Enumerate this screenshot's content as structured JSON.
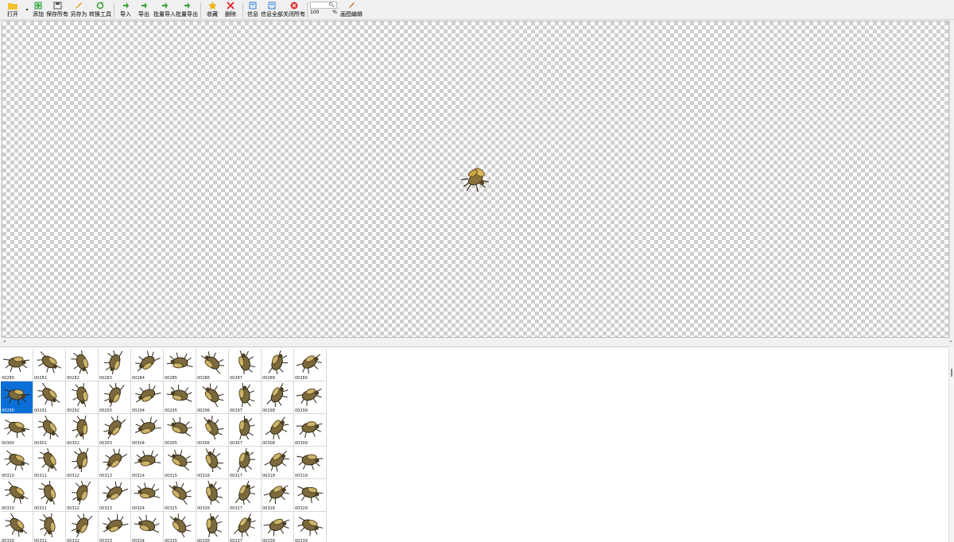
{
  "toolbar": {
    "items": [
      {
        "id": "open",
        "label": "打开",
        "icon": "folder-icon",
        "color": "#f3c12b"
      },
      {
        "id": "dropdown",
        "label": "",
        "icon": "chevron-down-icon"
      },
      {
        "id": "add",
        "label": "添加",
        "icon": "add-image-icon",
        "color": "#2e9e3a"
      },
      {
        "id": "save-all",
        "label": "保存所有",
        "icon": "save-all-icon",
        "color": "#555555"
      },
      {
        "id": "save-as",
        "label": "另存为",
        "icon": "pencil-icon",
        "color": "#e0a020"
      },
      {
        "id": "convert",
        "label": "转换工具",
        "icon": "refresh-icon",
        "color": "#3aa43a"
      },
      {
        "id": "import",
        "label": "导入",
        "icon": "import-icon",
        "color": "#2ea02e"
      },
      {
        "id": "export",
        "label": "导出",
        "icon": "export-icon",
        "color": "#2ea02e"
      },
      {
        "id": "batch-import",
        "label": "批量导入",
        "icon": "batch-import-icon",
        "color": "#2ea02e"
      },
      {
        "id": "batch-export",
        "label": "批量导出",
        "icon": "batch-export-icon",
        "color": "#2ea02e"
      },
      {
        "id": "favorite",
        "label": "收藏",
        "icon": "star-icon",
        "color": "#f1b40f"
      },
      {
        "id": "delete",
        "label": "删除",
        "icon": "delete-x-icon",
        "color": "#e02020"
      },
      {
        "id": "info",
        "label": "信息",
        "icon": "info-icon",
        "color": "#3a7fd0"
      },
      {
        "id": "info-all",
        "label": "信息全部",
        "icon": "info-all-icon",
        "color": "#3a7fd0"
      },
      {
        "id": "close-all",
        "label": "关闭所有",
        "icon": "close-circle-icon",
        "color": "#e03030"
      }
    ],
    "zoom": {
      "search_placeholder": "",
      "value": "100",
      "unit": "%"
    },
    "edit": {
      "label": "画图编辑",
      "icon": "brush-icon",
      "color": "#c07a2a"
    }
  },
  "canvas": {
    "preview_icon": "beetle-sprite"
  },
  "scroll": {
    "left_arrow": "◂",
    "right_arrow": "▸"
  },
  "thumbnails": {
    "selected": "00290",
    "items": [
      "00280",
      "00281",
      "00282",
      "00283",
      "00284",
      "00285",
      "00286",
      "00287",
      "00288",
      "00289",
      "00290",
      "00291",
      "00292",
      "00293",
      "00294",
      "00295",
      "00296",
      "00297",
      "00298",
      "00299",
      "00300",
      "00301",
      "00302",
      "00303",
      "00304",
      "00305",
      "00306",
      "00307",
      "00308",
      "00309",
      "00310",
      "00311",
      "00312",
      "00313",
      "00314",
      "00315",
      "00316",
      "00317",
      "00318",
      "00319",
      "00320",
      "00321",
      "00322",
      "00323",
      "00324",
      "00325",
      "00326",
      "00327",
      "00328",
      "00329",
      "00330",
      "00331",
      "00332",
      "00333",
      "00334",
      "00335",
      "00336",
      "00337",
      "00338",
      "00339"
    ]
  }
}
